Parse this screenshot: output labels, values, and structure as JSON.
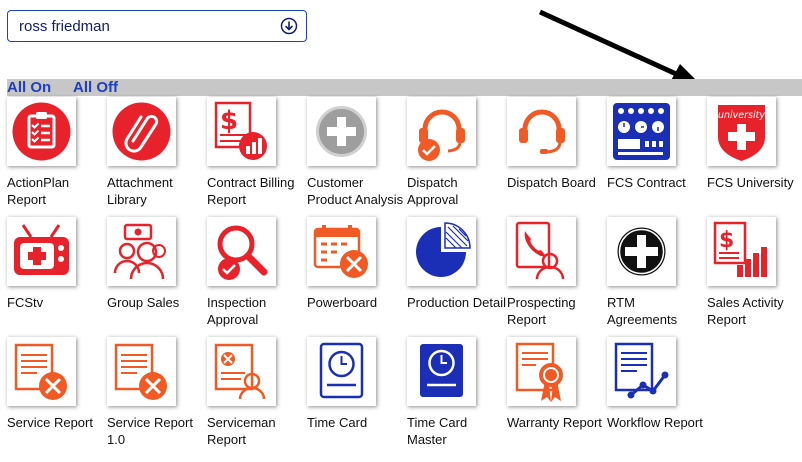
{
  "user_select": {
    "value": "ross friedman",
    "icon": "chevron-down-circle-icon"
  },
  "toggles": {
    "all_on": "All On",
    "all_off": "All Off"
  },
  "colors": {
    "red": "#e8222a",
    "orange": "#f15a24",
    "blue": "#1a2fb5",
    "link": "#1f3fbf"
  },
  "apps": [
    {
      "label": "ActionPlan Report",
      "icon": "clipboard-checklist-icon"
    },
    {
      "label": "Attachment Library",
      "icon": "paperclip-icon"
    },
    {
      "label": "Contract Billing Report",
      "icon": "dollar-document-chart-icon"
    },
    {
      "label": "Customer Product Analysis",
      "icon": "plus-circle-gray-icon"
    },
    {
      "label": "Dispatch Approval",
      "icon": "headset-check-icon"
    },
    {
      "label": "Dispatch Board",
      "icon": "headset-icon"
    },
    {
      "label": "FCS Contract",
      "icon": "contract-dashboard-icon"
    },
    {
      "label": "FCS University",
      "icon": "university-shield-icon"
    },
    {
      "label": "FCStv",
      "icon": "tv-plus-icon"
    },
    {
      "label": "Group Sales",
      "icon": "group-money-icon"
    },
    {
      "label": "Inspection Approval",
      "icon": "magnifier-check-icon"
    },
    {
      "label": "Powerboard",
      "icon": "calendar-tools-icon"
    },
    {
      "label": "Production Detail",
      "icon": "pie-chart-icon"
    },
    {
      "label": "Prospecting Report",
      "icon": "phone-person-icon"
    },
    {
      "label": "RTM Agreements",
      "icon": "plus-circle-black-icon"
    },
    {
      "label": "Sales Activity Report",
      "icon": "dollar-bar-chart-icon"
    },
    {
      "label": "Service Report",
      "icon": "document-tools-icon"
    },
    {
      "label": "Service Report 1.0",
      "icon": "document-tools-icon"
    },
    {
      "label": "Serviceman Report",
      "icon": "document-person-icon"
    },
    {
      "label": "Time Card",
      "icon": "clock-card-icon"
    },
    {
      "label": "Time Card Master",
      "icon": "clock-card-dark-icon"
    },
    {
      "label": "Warranty Report",
      "icon": "document-ribbon-icon"
    },
    {
      "label": "Workflow Report",
      "icon": "document-line-chart-icon"
    }
  ],
  "university_text": "university"
}
